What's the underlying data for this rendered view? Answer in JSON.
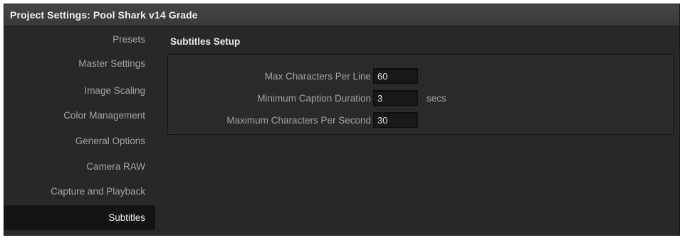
{
  "window": {
    "title": "Project Settings:  Pool Shark v14 Grade"
  },
  "sidebar": {
    "items": [
      {
        "label": "Presets"
      },
      {
        "label": "Master Settings"
      },
      {
        "label": "Image Scaling"
      },
      {
        "label": "Color Management"
      },
      {
        "label": "General Options"
      },
      {
        "label": "Camera RAW"
      },
      {
        "label": "Capture and Playback"
      },
      {
        "label": "Subtitles"
      }
    ],
    "selected": "Subtitles"
  },
  "main": {
    "section_title": "Subtitles Setup",
    "fields": [
      {
        "label": "Max Characters Per Line",
        "value": "60",
        "unit": ""
      },
      {
        "label": "Minimum Caption Duration",
        "value": "3",
        "unit": "secs"
      },
      {
        "label": "Maximum Characters Per Second",
        "value": "30",
        "unit": ""
      }
    ]
  },
  "colors": {
    "window_bg": "#282828",
    "titlebar_bg": "#3f3f3f",
    "selected_item_bg": "#141414",
    "input_bg": "#191919",
    "label_text": "#a3a3a3",
    "bright_text": "#f0f0f0"
  }
}
